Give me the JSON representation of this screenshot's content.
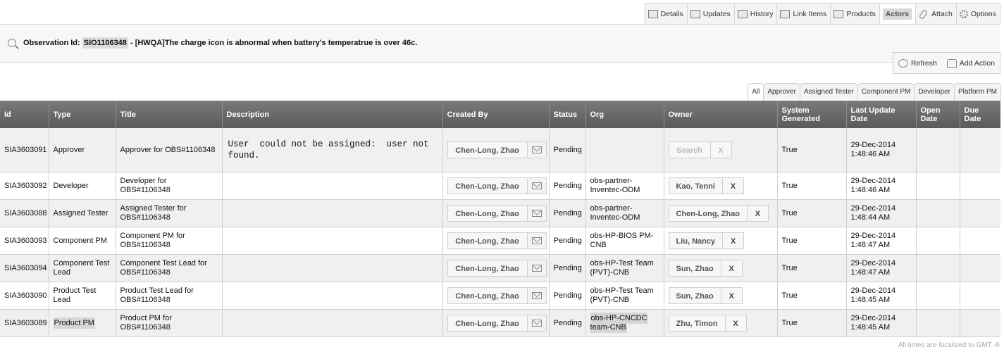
{
  "top_tabs": [
    {
      "label": "Details",
      "icon": "details-icon"
    },
    {
      "label": "Updates",
      "icon": "updates-icon"
    },
    {
      "label": "History",
      "icon": "history-icon"
    },
    {
      "label": "Link Items",
      "icon": "link-items-icon"
    },
    {
      "label": "Products",
      "icon": "products-icon"
    },
    {
      "label": "Actors",
      "icon": "",
      "active": true
    },
    {
      "label": "Attach",
      "icon": "paperclip-icon"
    },
    {
      "label": "Options",
      "icon": "gear-icon"
    }
  ],
  "observation": {
    "prefix": "Observation Id: ",
    "id": "SIO1106348",
    "title": " - [HWQA]The charge icon is abnormal when battery's temperatrue is over 46c."
  },
  "actions": {
    "refresh": "Refresh",
    "add_action": "Add Action"
  },
  "role_tabs": [
    "All",
    "Approver",
    "Assigned Tester",
    "Component PM",
    "Developer",
    "Platform PM"
  ],
  "table": {
    "headers": [
      "Id",
      "Type",
      "Title",
      "Description",
      "Created By",
      "Status",
      "Org",
      "Owner",
      "System Generated",
      "Last Update Date",
      "Open Date",
      "Due Date"
    ],
    "search_label": "Search",
    "remove_label": "X",
    "rows": [
      {
        "id": "SIA3603091",
        "type": "Approver",
        "title": "Approver for OBS#1106348",
        "description": "User  could not be assigned:  user not found.",
        "created_by": "Chen-Long, Zhao",
        "status": "Pending",
        "org": "",
        "owner": "",
        "system_generated": "True",
        "last_update": "29-Dec-2014 1:48:46 AM",
        "open_date": "",
        "due_date": ""
      },
      {
        "id": "SIA3603092",
        "type": "Developer",
        "title": "Developer for OBS#1106348",
        "description": "",
        "created_by": "Chen-Long, Zhao",
        "status": "Pending",
        "org": "obs-partner-Inventec-ODM",
        "owner": "Kao, Tenni",
        "system_generated": "True",
        "last_update": "29-Dec-2014 1:48:46 AM",
        "open_date": "",
        "due_date": ""
      },
      {
        "id": "SIA3603088",
        "type": "Assigned Tester",
        "title": "Assigned Tester for OBS#1106348",
        "description": "",
        "created_by": "Chen-Long, Zhao",
        "status": "Pending",
        "org": "obs-partner-Inventec-ODM",
        "owner": "Chen-Long, Zhao",
        "system_generated": "True",
        "last_update": "29-Dec-2014 1:48:44 AM",
        "open_date": "",
        "due_date": ""
      },
      {
        "id": "SIA3603093",
        "type": "Component PM",
        "title": "Component PM for OBS#1106348",
        "description": "",
        "created_by": "Chen-Long, Zhao",
        "status": "Pending",
        "org": "obs-HP-BIOS PM-CNB",
        "owner": "Liu, Nancy",
        "system_generated": "True",
        "last_update": "29-Dec-2014 1:48:47 AM",
        "open_date": "",
        "due_date": ""
      },
      {
        "id": "SIA3603094",
        "type": "Component Test Lead",
        "title": "Component Test Lead for OBS#1106348",
        "description": "",
        "created_by": "Chen-Long, Zhao",
        "status": "Pending",
        "org": "obs-HP-Test Team (PVT)-CNB",
        "owner": "Sun, Zhao",
        "system_generated": "True",
        "last_update": "29-Dec-2014 1:48:47 AM",
        "open_date": "",
        "due_date": ""
      },
      {
        "id": "SIA3603090",
        "type": "Product Test Lead",
        "title": "Product Test Lead for OBS#1106348",
        "description": "",
        "created_by": "Chen-Long, Zhao",
        "status": "Pending",
        "org": "obs-HP-Test Team (PVT)-CNB",
        "owner": "Sun, Zhao",
        "system_generated": "True",
        "last_update": "29-Dec-2014 1:48:45 AM",
        "open_date": "",
        "due_date": ""
      },
      {
        "id": "SIA3603089",
        "type": "Product PM",
        "title": "Product PM for OBS#1106348",
        "description": "",
        "created_by": "Chen-Long, Zhao",
        "status": "Pending",
        "org": "obs-HP-CNCDC team-CNB",
        "owner": "Zhu, Timon",
        "system_generated": "True",
        "last_update": "29-Dec-2014 1:48:45 AM",
        "open_date": "",
        "due_date": ""
      }
    ]
  },
  "footer_note": "All times are localized to GMT -6"
}
